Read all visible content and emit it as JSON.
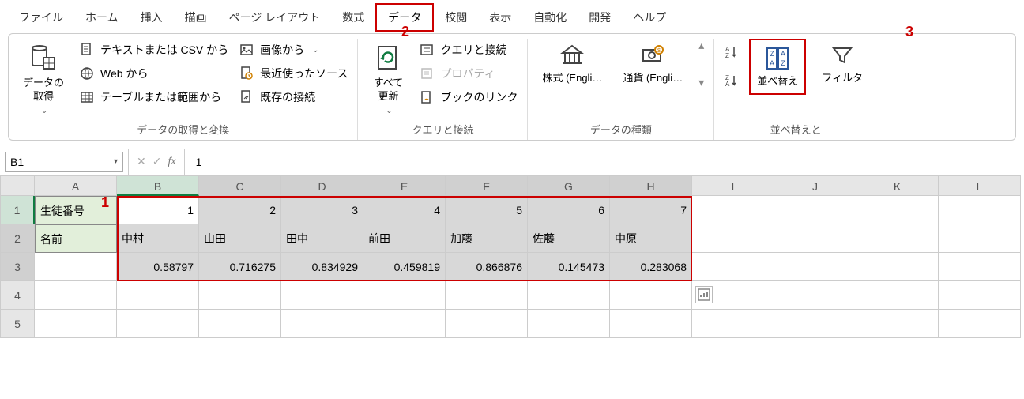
{
  "menu": {
    "items": [
      "ファイル",
      "ホーム",
      "挿入",
      "描画",
      "ページ レイアウト",
      "数式",
      "データ",
      "校閲",
      "表示",
      "自動化",
      "開発",
      "ヘルプ"
    ],
    "active": "データ"
  },
  "annotations": {
    "a1": "1",
    "a2": "2",
    "a3": "3"
  },
  "ribbon": {
    "get_transform": {
      "get_data": "データの\n取得",
      "from_csv": "テキストまたは CSV から",
      "from_web": "Web から",
      "from_table": "テーブルまたは範囲から",
      "from_image": "画像から",
      "recent": "最近使ったソース",
      "existing": "既存の接続",
      "title": "データの取得と変換"
    },
    "queries": {
      "refresh": "すべて\n更新",
      "queries_conn": "クエリと接続",
      "properties": "プロパティ",
      "book_link": "ブックのリンク",
      "title": "クエリと接続"
    },
    "types": {
      "stocks": "株式 (Engli…",
      "currency": "通貨 (Engli…",
      "title": "データの種類"
    },
    "sort": {
      "sort_btn": "並べ替え",
      "filter": "フィルタ",
      "title": "並べ替えと"
    }
  },
  "namebox": "B1",
  "formula": "1",
  "grid": {
    "cols": [
      "A",
      "B",
      "C",
      "D",
      "E",
      "F",
      "G",
      "H",
      "I",
      "J",
      "K",
      "L"
    ],
    "row_headers": [
      "1",
      "2",
      "3",
      "4",
      "5"
    ],
    "labels": {
      "student_no": "生徒番号",
      "name": "名前"
    },
    "numbers": [
      "1",
      "2",
      "3",
      "4",
      "5",
      "6",
      "7"
    ],
    "names": [
      "中村",
      "山田",
      "田中",
      "前田",
      "加藤",
      "佐藤",
      "中原"
    ],
    "rands": [
      "0.58797",
      "0.716275",
      "0.834929",
      "0.459819",
      "0.866876",
      "0.145473",
      "0.283068"
    ]
  }
}
